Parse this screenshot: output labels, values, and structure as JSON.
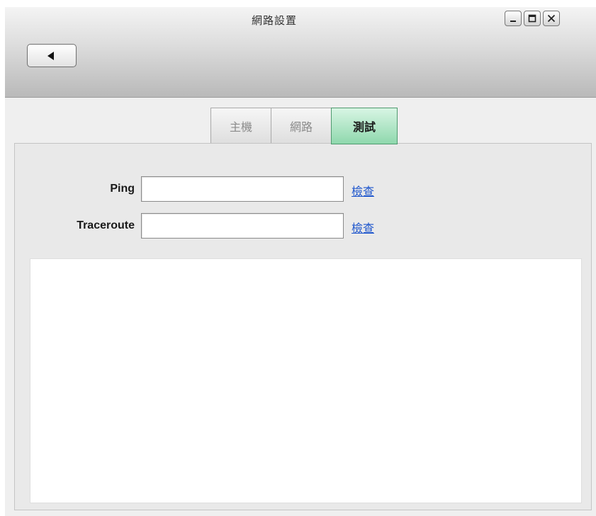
{
  "window": {
    "title": "網路設置",
    "controls": {
      "minimize_icon": "minimize-icon",
      "maximize_icon": "maximize-icon",
      "close_icon": "close-icon"
    },
    "back_icon": "left-triangle-icon"
  },
  "tabs": [
    {
      "label": "主機",
      "active": false
    },
    {
      "label": "網路",
      "active": false
    },
    {
      "label": "測試",
      "active": true
    }
  ],
  "form": {
    "ping": {
      "label": "Ping",
      "value": "",
      "action_label": "檢查"
    },
    "traceroute": {
      "label": "Traceroute",
      "value": "",
      "action_label": "檢查"
    }
  },
  "output": {
    "text": ""
  },
  "colors": {
    "active_tab": "#8fd8ad",
    "link": "#1a53cc",
    "panel_bg": "#e9e9e9"
  }
}
